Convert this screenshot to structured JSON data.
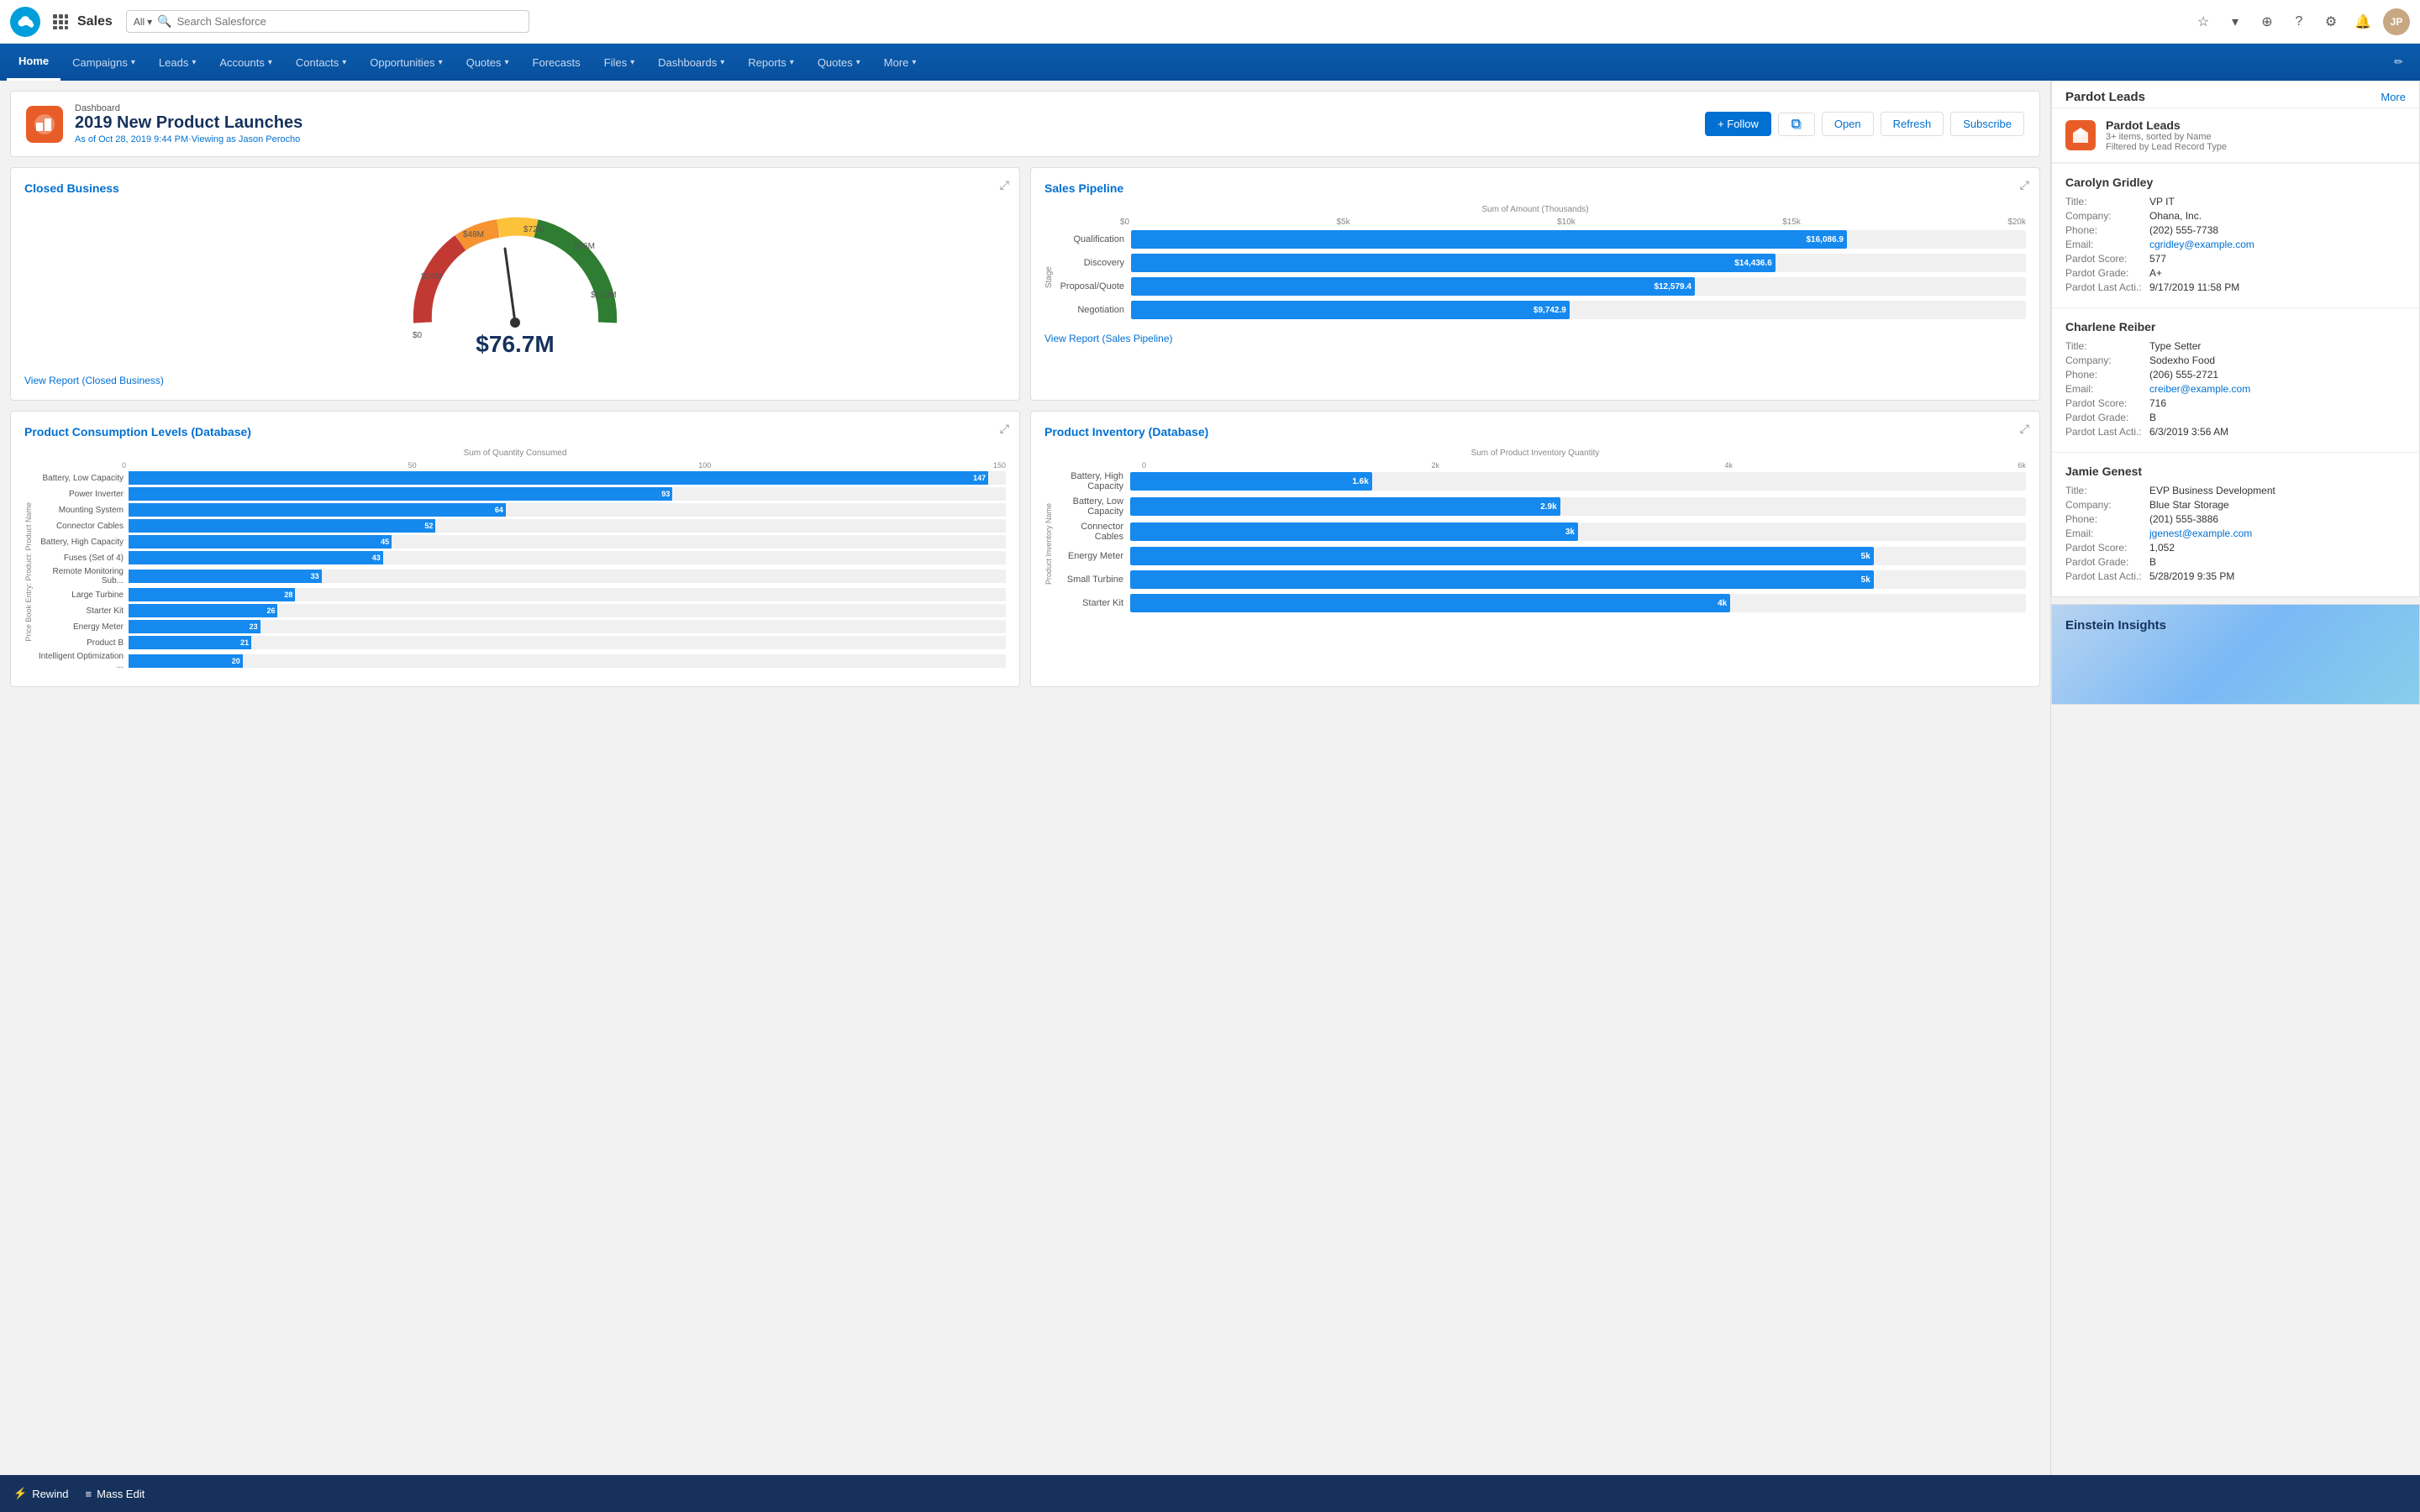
{
  "topNav": {
    "appName": "Sales",
    "searchPlaceholder": "Search Salesforce",
    "searchPrefix": "All"
  },
  "mainNav": {
    "tabs": [
      {
        "id": "home",
        "label": "Home",
        "hasDropdown": false,
        "active": true
      },
      {
        "id": "campaigns",
        "label": "Campaigns",
        "hasDropdown": true,
        "active": false
      },
      {
        "id": "leads",
        "label": "Leads",
        "hasDropdown": true,
        "active": false
      },
      {
        "id": "accounts",
        "label": "Accounts",
        "hasDropdown": true,
        "active": false
      },
      {
        "id": "contacts",
        "label": "Contacts",
        "hasDropdown": true,
        "active": false
      },
      {
        "id": "opportunities",
        "label": "Opportunities",
        "hasDropdown": true,
        "active": false
      },
      {
        "id": "quotes",
        "label": "Quotes",
        "hasDropdown": true,
        "active": false
      },
      {
        "id": "forecasts",
        "label": "Forecasts",
        "hasDropdown": false,
        "active": false
      },
      {
        "id": "files",
        "label": "Files",
        "hasDropdown": true,
        "active": false
      },
      {
        "id": "dashboards",
        "label": "Dashboards",
        "hasDropdown": true,
        "active": false
      },
      {
        "id": "reports",
        "label": "Reports",
        "hasDropdown": true,
        "active": false
      },
      {
        "id": "quotes2",
        "label": "Quotes",
        "hasDropdown": true,
        "active": false
      },
      {
        "id": "more",
        "label": "More",
        "hasDropdown": true,
        "active": false
      }
    ]
  },
  "dashboard": {
    "label": "Dashboard",
    "title": "2019 New Product Launches",
    "subtitle": "As of Oct 28, 2019 9:44 PM·Viewing as Jason Perocho",
    "followBtn": "+ Follow",
    "openBtn": "Open",
    "refreshBtn": "Refresh",
    "subscribeBtn": "Subscribe"
  },
  "closedBusiness": {
    "title": "Closed Business",
    "viewReportLink": "View Report (Closed Business)",
    "currentValue": "$76.7M",
    "segments": [
      {
        "label": "$0",
        "angle": 0
      },
      {
        "label": "$24M",
        "angle": 40
      },
      {
        "label": "$48M",
        "angle": 80
      },
      {
        "label": "$72M",
        "angle": 120
      },
      {
        "label": "$96M",
        "angle": 155
      },
      {
        "label": "$120M",
        "angle": 180
      }
    ]
  },
  "salesPipeline": {
    "title": "Sales Pipeline",
    "viewReportLink": "View Report (Sales Pipeline)",
    "axisLabel": "Sum of Amount (Thousands)",
    "axisValues": [
      "$0",
      "$5k",
      "$10k",
      "$15k",
      "$20k"
    ],
    "yAxisLabel": "Stage",
    "bars": [
      {
        "label": "Qualification",
        "value": "$16,086.9",
        "pct": 80
      },
      {
        "label": "Discovery",
        "value": "$14,436.6",
        "pct": 72
      },
      {
        "label": "Proposal/Quote",
        "value": "$12,579.4",
        "pct": 63
      },
      {
        "label": "Negotiation",
        "value": "$9,742.9",
        "pct": 49
      }
    ]
  },
  "productConsumption": {
    "title": "Product Consumption Levels (Database)",
    "axisLabel": "Sum of Quantity Consumed",
    "axisValues": [
      "0",
      "50",
      "100",
      "150"
    ],
    "yAxisLabel": "Price Book Entry: Product: Product Name",
    "bars": [
      {
        "label": "Battery, Low Capacity",
        "value": "147",
        "pct": 98
      },
      {
        "label": "Power Inverter",
        "value": "93",
        "pct": 62
      },
      {
        "label": "Mounting System",
        "value": "64",
        "pct": 43
      },
      {
        "label": "Connector Cables",
        "value": "52",
        "pct": 35
      },
      {
        "label": "Battery, High Capacity",
        "value": "45",
        "pct": 30
      },
      {
        "label": "Fuses (Set of 4)",
        "value": "43",
        "pct": 29
      },
      {
        "label": "Remote Monitoring Sub...",
        "value": "33",
        "pct": 22
      },
      {
        "label": "Large Turbine",
        "value": "28",
        "pct": 19
      },
      {
        "label": "Starter Kit",
        "value": "26",
        "pct": 17
      },
      {
        "label": "Energy Meter",
        "value": "23",
        "pct": 15
      },
      {
        "label": "Product B",
        "value": "21",
        "pct": 14
      },
      {
        "label": "Intelligent Optimization ...",
        "value": "20",
        "pct": 13
      }
    ]
  },
  "productInventory": {
    "title": "Product Inventory (Database)",
    "axisLabel": "Sum of Product Inventory Quantity",
    "axisValues": [
      "0",
      "2k",
      "4k",
      "6k"
    ],
    "yAxisLabel": "Product Inventory Name",
    "bars": [
      {
        "label": "Battery, High Capacity",
        "value": "1.6k",
        "pct": 27
      },
      {
        "label": "Battery, Low Capacity",
        "value": "2.9k",
        "pct": 48
      },
      {
        "label": "Connector Cables",
        "value": "3k",
        "pct": 50
      },
      {
        "label": "Energy Meter",
        "value": "5k",
        "pct": 83
      },
      {
        "label": "Small Turbine",
        "value": "5k",
        "pct": 83
      },
      {
        "label": "Starter Kit",
        "value": "4k",
        "pct": 67
      }
    ]
  },
  "pardotLeads": {
    "sectionTitle": "Pardot Leads",
    "moreLabel": "More",
    "headerTitle": "Pardot Leads",
    "headerSub1": "3+ items, sorted by Name",
    "headerSub2": "Filtered by Lead Record Type",
    "leads": [
      {
        "name": "Carolyn Gridley",
        "title": "VP IT",
        "company": "Ohana, Inc.",
        "phone": "(202) 555-7738",
        "email": "cgridley@example.com",
        "pardotScore": "577",
        "pardotGrade": "A+",
        "pardotLastActi": "9/17/2019 11:58 PM"
      },
      {
        "name": "Charlene Reiber",
        "title": "Type Setter",
        "company": "Sodexho Food",
        "phone": "(206) 555-2721",
        "email": "creiber@example.com",
        "pardotScore": "716",
        "pardotGrade": "B",
        "pardotLastActi": "6/3/2019 3:56 AM"
      },
      {
        "name": "Jamie Genest",
        "title": "EVP Business Development",
        "company": "Blue Star Storage",
        "phone": "(201) 555-3886",
        "email": "jgenest@example.com",
        "pardotScore": "1,052",
        "pardotGrade": "B",
        "pardotLastActi": "5/28/2019 9:35 PM"
      }
    ]
  },
  "einsteinInsights": {
    "title": "Einstein Insights"
  },
  "bottomBar": {
    "rewindLabel": "Rewind",
    "massEditLabel": "Mass Edit"
  }
}
